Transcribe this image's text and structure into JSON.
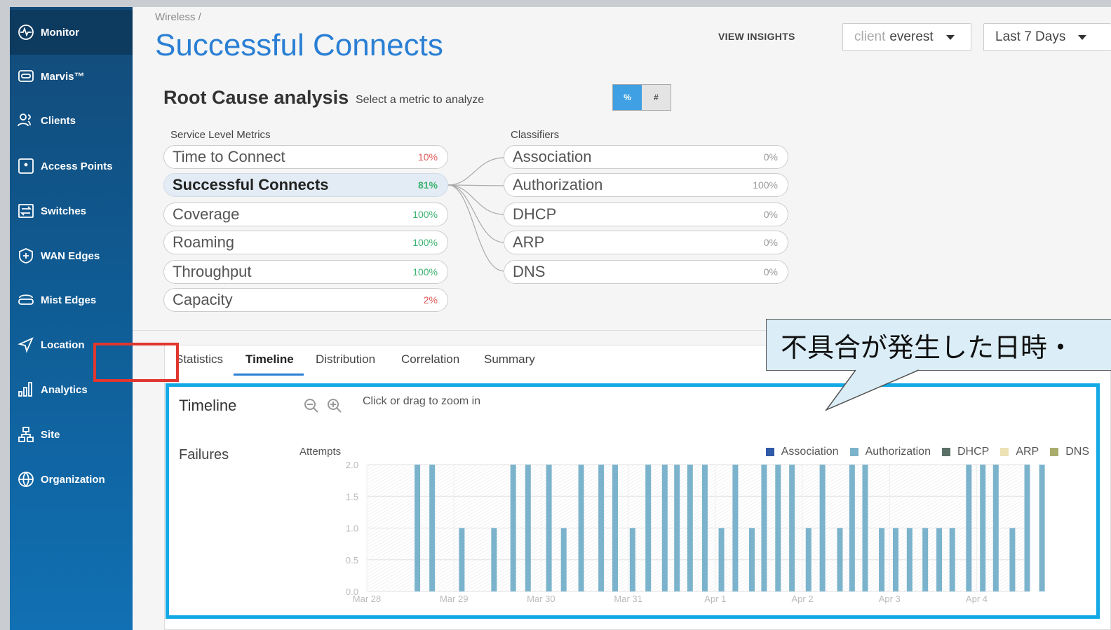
{
  "sidebar": {
    "items": [
      {
        "label": "Monitor",
        "icon": "monitor-icon",
        "active": true
      },
      {
        "label": "Marvis™",
        "icon": "marvis-icon"
      },
      {
        "label": "Clients",
        "icon": "clients-icon"
      },
      {
        "label": "Access Points",
        "icon": "access-point-icon"
      },
      {
        "label": "Switches",
        "icon": "switch-icon"
      },
      {
        "label": "WAN Edges",
        "icon": "wan-edge-icon"
      },
      {
        "label": "Mist Edges",
        "icon": "mist-edge-icon"
      },
      {
        "label": "Location",
        "icon": "location-icon"
      },
      {
        "label": "Analytics",
        "icon": "analytics-icon"
      },
      {
        "label": "Site",
        "icon": "site-icon"
      },
      {
        "label": "Organization",
        "icon": "organization-icon"
      }
    ]
  },
  "header": {
    "breadcrumb": "Wireless /",
    "title": "Successful Connects",
    "view_insights": "VIEW INSIGHTS",
    "client_prefix": "client",
    "client_value": "everest",
    "range": "Last 7 Days"
  },
  "rca": {
    "title": "Root Cause analysis",
    "subtitle": "Select a metric to analyze",
    "toggle_percent": "%",
    "toggle_count": "#",
    "slm_label": "Service Level Metrics",
    "classifiers_label": "Classifiers",
    "metrics": [
      {
        "label": "Time to Connect",
        "value": "10%",
        "status": "bad"
      },
      {
        "label": "Successful Connects",
        "value": "81%",
        "status": "good",
        "selected": true
      },
      {
        "label": "Coverage",
        "value": "100%",
        "status": "good"
      },
      {
        "label": "Roaming",
        "value": "100%",
        "status": "good"
      },
      {
        "label": "Throughput",
        "value": "100%",
        "status": "good"
      },
      {
        "label": "Capacity",
        "value": "2%",
        "status": "bad"
      }
    ],
    "classifiers": [
      {
        "label": "Association",
        "value": "0%"
      },
      {
        "label": "Authorization",
        "value": "100%"
      },
      {
        "label": "DHCP",
        "value": "0%"
      },
      {
        "label": "ARP",
        "value": "0%"
      },
      {
        "label": "DNS",
        "value": "0%"
      }
    ]
  },
  "tabs": [
    "Statistics",
    "Timeline",
    "Distribution",
    "Correlation",
    "Summary"
  ],
  "active_tab": "Timeline",
  "timeline": {
    "title": "Timeline",
    "zoom_hint": "Click or drag to zoom in",
    "failures_label": "Failures"
  },
  "callout": {
    "text": "不具合が発生した日時・"
  },
  "colors": {
    "accent": "#2a7fd4",
    "highlight_red": "#e0372f",
    "highlight_blue": "#12a9e6",
    "bar": "#7bb3cc"
  },
  "chart_data": {
    "type": "bar",
    "ylabel": "Attempts",
    "ylim": [
      0,
      2.0
    ],
    "yticks": [
      0.0,
      0.5,
      1.0,
      1.5,
      2.0
    ],
    "ytick_labels": [
      "0.0",
      "0.5",
      "1.0",
      "1.5",
      "2.0"
    ],
    "xticks": [
      "Mar 28",
      "Mar 29",
      "Mar 30",
      "Mar 31",
      "Apr 1",
      "Apr 2",
      "Apr 3",
      "Apr 4"
    ],
    "x_unit": "days since Mar 28",
    "grid": true,
    "legend_position": "top-right",
    "series": [
      {
        "name": "Association",
        "color": "#2e5aa8",
        "values": []
      },
      {
        "name": "Authorization",
        "color": "#7bb3cc",
        "x": [
          0.58,
          0.75,
          1.09,
          1.46,
          1.68,
          1.85,
          2.09,
          2.26,
          2.46,
          2.69,
          2.85,
          3.05,
          3.23,
          3.42,
          3.56,
          3.71,
          3.88,
          4.07,
          4.23,
          4.42,
          4.56,
          4.72,
          4.88,
          5.07,
          5.23,
          5.43,
          5.57,
          5.72,
          5.91,
          6.07,
          6.23,
          6.41,
          6.57,
          6.72,
          6.91,
          7.07,
          7.22,
          7.41,
          7.58,
          7.75
        ],
        "values": [
          2,
          2,
          1,
          1,
          2,
          2,
          2,
          1,
          2,
          2,
          2,
          1,
          2,
          2,
          2,
          2,
          2,
          1,
          2,
          1,
          2,
          2,
          2,
          1,
          2,
          1,
          2,
          2,
          1,
          1,
          1,
          1,
          1,
          1,
          2,
          2,
          2,
          1,
          2,
          2
        ]
      },
      {
        "name": "DHCP",
        "color": "#5a7066",
        "values": []
      },
      {
        "name": "ARP",
        "color": "#ece2b4",
        "values": []
      },
      {
        "name": "DNS",
        "color": "#a8ad6c",
        "values": []
      }
    ]
  }
}
